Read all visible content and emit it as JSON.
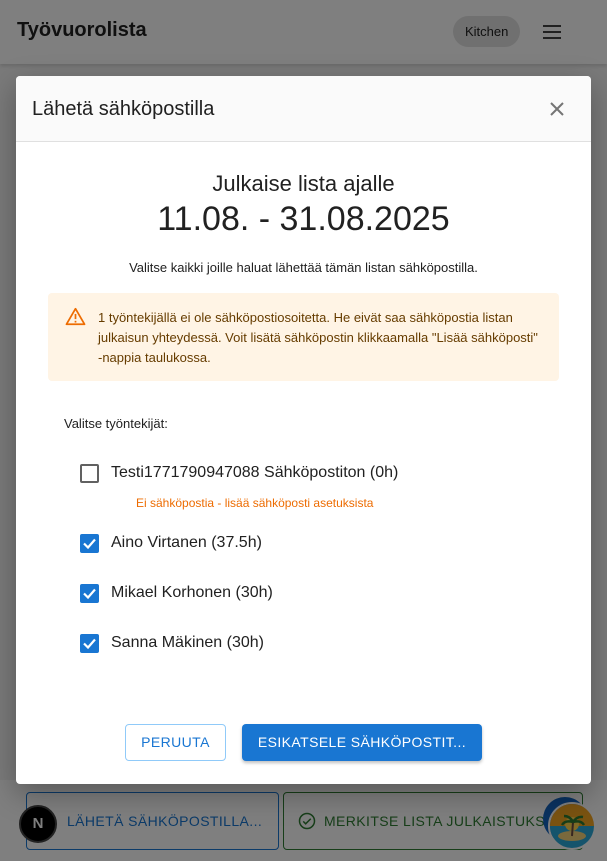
{
  "app": {
    "title": "Työvuorolista",
    "location_chip": "Kitchen",
    "menu_icon": "hamburger-menu-icon"
  },
  "bottom_actions": {
    "send_email_label": "LÄHETÄ SÄHKÖPOSTILLA...",
    "mark_published_label": "MERKITSE LISTA JULKAISTUKSI",
    "next_badge": "N"
  },
  "dialog": {
    "title": "Lähetä sähköpostilla",
    "close_icon": "close-icon",
    "heading_line1": "Julkaise lista ajalle",
    "heading_line2": "11.08. - 31.08.2025",
    "intro": "Valitse kaikki joille haluat lähettää tämän listan sähköpostilla.",
    "alert": {
      "icon": "warning-triangle-icon",
      "text": "1 työntekijällä ei ole sähköpostiosoitetta. He eivät saa sähköpostia listan julkaisun yhteydessä. Voit lisätä sähköpostin klikkaamalla \"Lisää sähköposti\" -nappia taulukossa."
    },
    "select_label": "Valitse työntekijät:",
    "employees": [
      {
        "name": "Testi1771790947088 Sähköpostiton (0h)",
        "checked": false,
        "note": "Ei sähköpostia - lisää sähköposti asetuksista"
      },
      {
        "name": "Aino Virtanen (37.5h)",
        "checked": true
      },
      {
        "name": "Mikael Korhonen (30h)",
        "checked": true
      },
      {
        "name": "Sanna Mäkinen (30h)",
        "checked": true
      }
    ],
    "cancel_label": "PERUUTA",
    "preview_label": "ESIKATSELE SÄHKÖPOSTIT..."
  },
  "colors": {
    "primary": "#1976d2",
    "warning_bg": "#fff4e5",
    "warning_text": "#663c00",
    "warning_accent": "#ed6c02",
    "success": "#2e7d32"
  }
}
